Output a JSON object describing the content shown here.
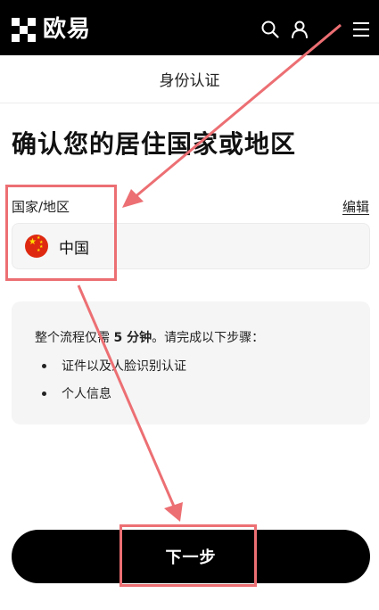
{
  "header": {
    "logo_text": "欧易"
  },
  "subheader": {
    "title": "身份认证"
  },
  "main": {
    "title": "确认您的居住国家或地区",
    "field_label": "国家/地区",
    "edit_label": "编辑",
    "country": "中国"
  },
  "info": {
    "lead_prefix": "整个流程仅需 ",
    "lead_bold": "5 分钟",
    "lead_suffix": "。请完成以下步骤：",
    "steps": [
      "证件以及人脸识别认证",
      "个人信息"
    ]
  },
  "footer": {
    "next_label": "下一步"
  },
  "icons": {
    "search": "search-icon",
    "user": "user-icon",
    "menu": "menu-icon",
    "flag": "china-flag-icon"
  },
  "colors": {
    "annotation": "#ec6f73",
    "button": "#000000"
  }
}
